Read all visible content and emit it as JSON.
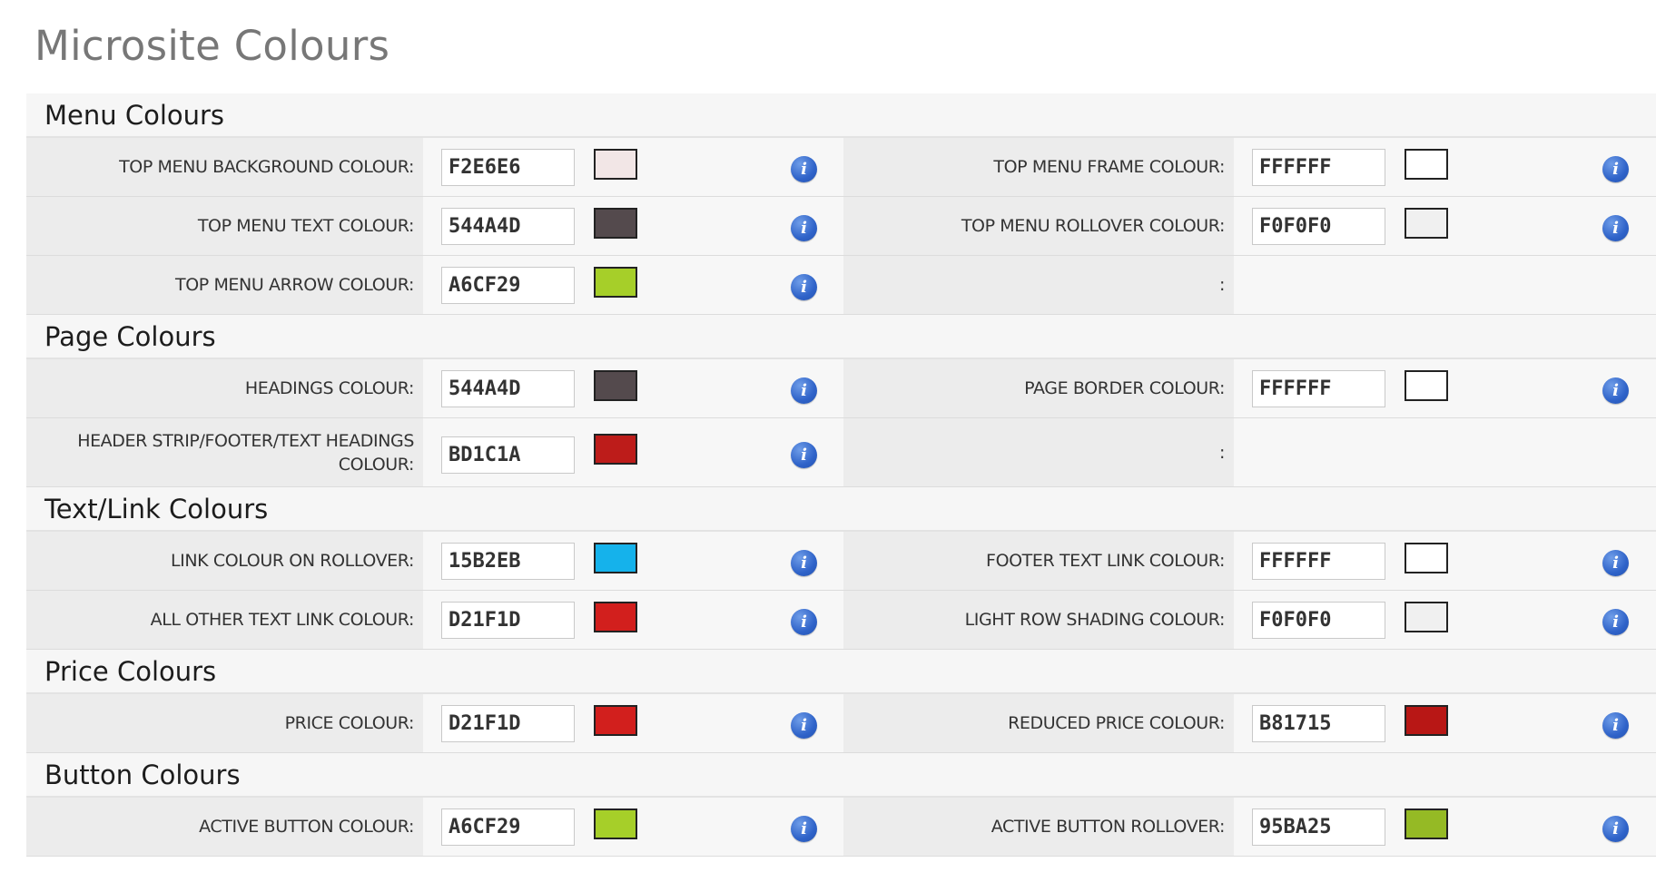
{
  "page": {
    "title": "Microsite Colours"
  },
  "info_icon_glyph": "i",
  "sections": [
    {
      "title": "Menu Colours",
      "rows": [
        {
          "left": {
            "label": "TOP MENU BACKGROUND COLOUR:",
            "value": "F2E6E6",
            "color": "#F2E6E6"
          },
          "right": {
            "label": "TOP MENU FRAME COLOUR:",
            "value": "FFFFFF",
            "color": "#FFFFFF"
          }
        },
        {
          "left": {
            "label": "TOP MENU TEXT COLOUR:",
            "value": "544A4D",
            "color": "#544A4D"
          },
          "right": {
            "label": "TOP MENU ROLLOVER COLOUR:",
            "value": "F0F0F0",
            "color": "#F0F0F0"
          }
        },
        {
          "left": {
            "label": "TOP MENU ARROW COLOUR:",
            "value": "A6CF29",
            "color": "#A6CF29"
          },
          "right": {
            "label": ":"
          }
        }
      ]
    },
    {
      "title": "Page Colours",
      "rows": [
        {
          "left": {
            "label": "HEADINGS COLOUR:",
            "value": "544A4D",
            "color": "#544A4D"
          },
          "right": {
            "label": "PAGE BORDER COLOUR:",
            "value": "FFFFFF",
            "color": "#FFFFFF"
          }
        },
        {
          "tall": true,
          "left": {
            "label": "HEADER STRIP/FOOTER/TEXT HEADINGS COLOUR:",
            "value": "BD1C1A",
            "color": "#BD1C1A"
          },
          "right": {
            "label": ":"
          }
        }
      ]
    },
    {
      "title": "Text/Link Colours",
      "rows": [
        {
          "left": {
            "label": "LINK COLOUR ON ROLLOVER:",
            "value": "15B2EB",
            "color": "#15B2EB"
          },
          "right": {
            "label": "FOOTER TEXT LINK COLOUR:",
            "value": "FFFFFF",
            "color": "#FFFFFF"
          }
        },
        {
          "left": {
            "label": "ALL OTHER TEXT LINK COLOUR:",
            "value": "D21F1D",
            "color": "#D21F1D"
          },
          "right": {
            "label": "LIGHT ROW SHADING COLOUR:",
            "value": "F0F0F0",
            "color": "#F0F0F0"
          }
        }
      ]
    },
    {
      "title": "Price Colours",
      "rows": [
        {
          "left": {
            "label": "PRICE COLOUR:",
            "value": "D21F1D",
            "color": "#D21F1D"
          },
          "right": {
            "label": "REDUCED PRICE COLOUR:",
            "value": "B81715",
            "color": "#B81715"
          }
        }
      ]
    },
    {
      "title": "Button Colours",
      "rows": [
        {
          "left": {
            "label": "ACTIVE BUTTON COLOUR:",
            "value": "A6CF29",
            "color": "#A6CF29"
          },
          "right": {
            "label": "ACTIVE BUTTON ROLLOVER:",
            "value": "95BA25",
            "color": "#95BA25"
          }
        }
      ]
    }
  ]
}
